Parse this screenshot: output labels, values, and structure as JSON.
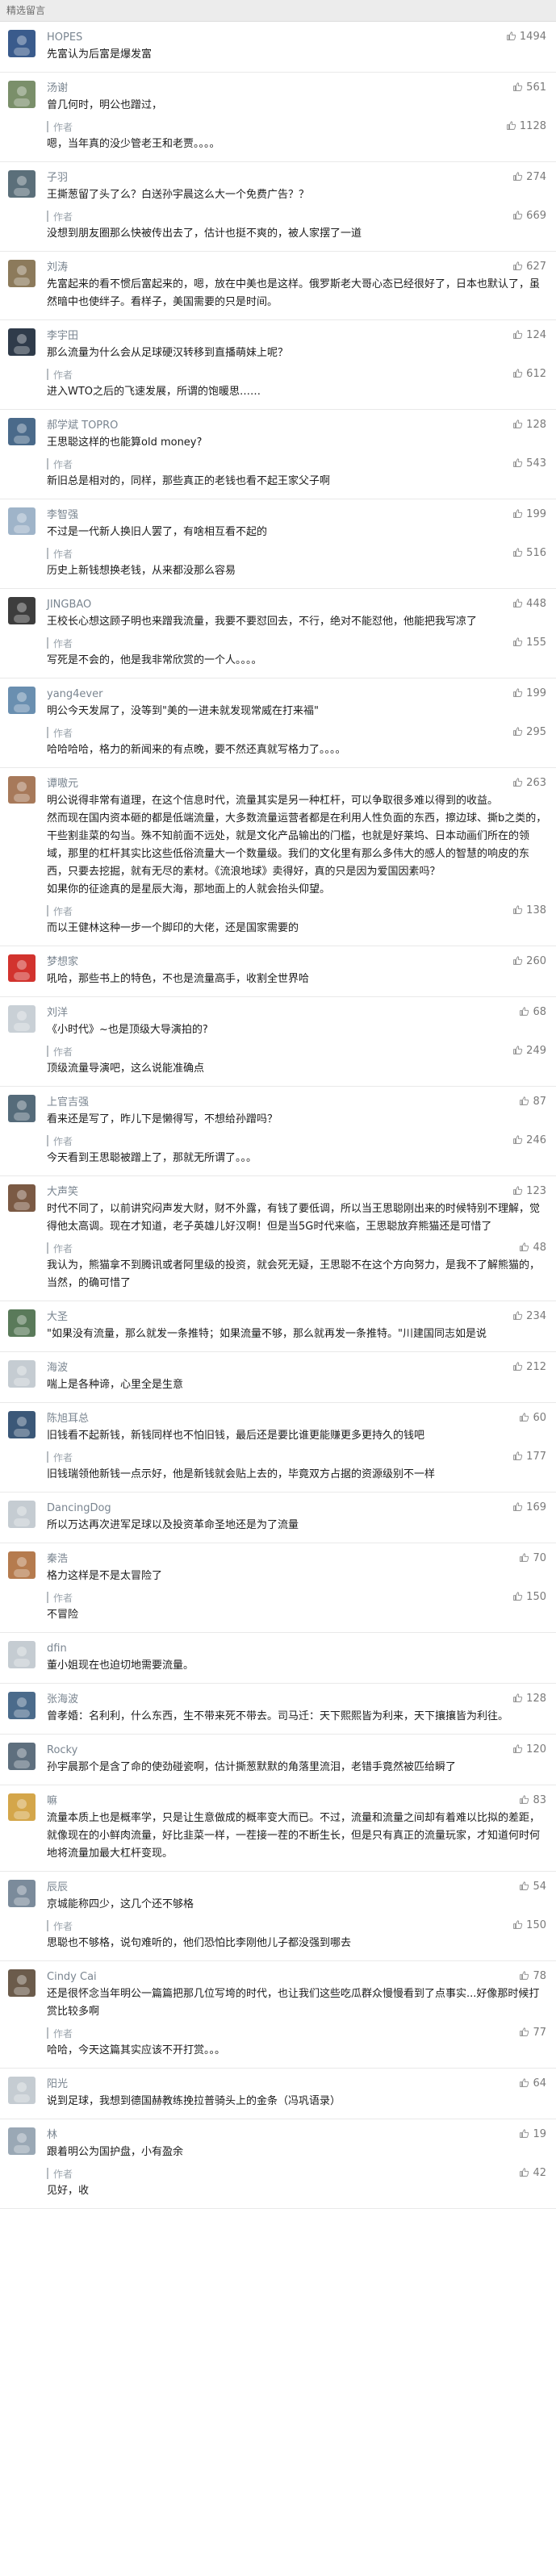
{
  "header": {
    "title": "精选留言"
  },
  "author_label": "作者",
  "comments": [
    {
      "name": "HOPES",
      "likes": "1494",
      "text": "先富认为后富是爆发富",
      "reply": null,
      "avatar_color": "#3a5b8c"
    },
    {
      "name": "汤谢",
      "likes": "561",
      "text": "曾几何时，明公也蹭过，",
      "reply": {
        "text": "嗯，当年真的没少管老王和老贾。。。。",
        "likes": "1128"
      },
      "avatar_color": "#7a8f6a"
    },
    {
      "name": "子羽",
      "likes": "274",
      "text": "王撕葱留了头了么？白送孙宇晨这么大一个免费广告？？",
      "reply": {
        "text": "没想到朋友圈那么快被传出去了，估计也挺不爽的，被人家摆了一道",
        "likes": "669"
      },
      "avatar_color": "#5b6f7a"
    },
    {
      "name": "刘涛",
      "likes": "627",
      "text": "先富起来的看不惯后富起来的，嗯，放在中美也是这样。俄罗斯老大哥心态已经很好了，日本也默认了，虽然暗中也使绊子。看样子，美国需要的只是时间。",
      "reply": null,
      "avatar_color": "#8c7a5b"
    },
    {
      "name": "李宇田",
      "likes": "124",
      "text": "那么流量为什么会从足球硬汉转移到直播萌妹上呢？",
      "reply": {
        "text": "进入WTO之后的飞速发展，所谓的饱暖思……",
        "likes": "612"
      },
      "avatar_color": "#2f3b4a"
    },
    {
      "name": "郝学斌 TOPRO",
      "likes": "128",
      "text": "王思聪这样的也能算old money?",
      "reply": {
        "text": "新旧总是相对的，同样，那些真正的老钱也看不起王家父子啊",
        "likes": "543"
      },
      "avatar_color": "#4a6a8a"
    },
    {
      "name": "李智强",
      "likes": "199",
      "text": "不过是一代新人换旧人罢了，有啥相互看不起的",
      "reply": {
        "text": "历史上新钱想换老钱，从来都没那么容易",
        "likes": "516"
      },
      "avatar_color": "#9fb4c9"
    },
    {
      "name": "JINGBAO",
      "likes": "448",
      "text": "王校长心想这顾子明也来蹭我流量，我要不要怼回去，不行，绝对不能怼他，他能把我写凉了",
      "reply": {
        "text": "写死是不会的，他是我非常欣赏的一个人。。。。",
        "likes": "155"
      },
      "avatar_color": "#3d3d3d"
    },
    {
      "name": "yang4ever",
      "likes": "199",
      "text": "明公今天发屌了，没等到\"美的一进未就发现常威在打来福\"",
      "reply": {
        "text": "哈哈哈哈，格力的新闻来的有点晚，要不然还真就写格力了。。。。",
        "likes": "295"
      },
      "avatar_color": "#6a8fb0"
    },
    {
      "name": "谭嗷元",
      "likes": "263",
      "text": "明公说得非常有道理，在这个信息时代，流量其实是另一种杠杆，可以争取很多难以得到的收益。\n然而现在国内资本砸的都是低端流量，大多数流量运营者都是在利用人性负面的东西，擦边球、撕b之类的，干些割韭菜的勾当。殊不知前面不远处，就是文化产品输出的门槛，也就是好莱坞、日本动画们所在的领域，那里的杠杆其实比这些低俗流量大一个数量级。我们的文化里有那么多伟大的感人的智慧的响皮的东西，只要去挖掘，就有无尽的素材。《流浪地球》卖得好，真的只是因为爱国因素吗？\n如果你的征途真的是星辰大海，那地面上的人就会抬头仰望。",
      "reply": {
        "text": "而以王健林这种一步一个脚印的大佬，还是国家需要的",
        "likes": "138"
      },
      "avatar_color": "#a7795a"
    },
    {
      "name": "梦想家",
      "likes": "260",
      "text": "吼哈，那些书上的特色，不也是流量高手，收割全世界哈",
      "reply": null,
      "avatar_color": "#d2332e"
    },
    {
      "name": "刘洋",
      "likes": "68",
      "text": "《小时代》~也是顶级大导演拍的?",
      "reply": {
        "text": "顶级流量导演吧，这么说能准确点",
        "likes": "249"
      },
      "avatar_color": "#c9d0d6"
    },
    {
      "name": "上官吉强",
      "likes": "87",
      "text": "看来还是写了，昨儿下是懒得写，不想给孙蹭吗？",
      "reply": {
        "text": "今天看到王思聪被蹭上了，那就无所谓了。。。",
        "likes": "246"
      },
      "avatar_color": "#556b7a"
    },
    {
      "name": "大声笑",
      "likes": "123",
      "text": "时代不同了，以前讲究闷声发大财，财不外露，有钱了要低调，所以当王思聪刚出来的时候特别不理解，觉得他太高调。现在才知道，老子英雄儿好汉啊！但是当5G时代来临，王思聪放弃熊猫还是可惜了",
      "reply": {
        "text": "我认为，熊猫拿不到腾讯或者阿里级的投资，就会死无疑，王思聪不在这个方向努力，是我不了解熊猫的，当然，的确可惜了",
        "likes": "48"
      },
      "avatar_color": "#7b5a44"
    },
    {
      "name": "大圣",
      "likes": "234",
      "text": "\"如果没有流量，那么就发一条推特；如果流量不够，那么就再发一条推特。\"川建国同志如是说",
      "reply": null,
      "avatar_color": "#5a7a5a"
    },
    {
      "name": "海波",
      "likes": "212",
      "text": "喘上是各种谛，心里全是生意",
      "reply": null,
      "avatar_color": "#c5ccd2"
    },
    {
      "name": "陈旭耳总",
      "likes": "60",
      "text": "旧钱看不起新钱，新钱同样也不怕旧钱，最后还是要比谁更能赚更多更持久的钱吧",
      "reply": {
        "text": "旧钱瑞领他新钱一点示好，他是新钱就会贴上去的，毕竟双方占据的资源级别不一样",
        "likes": "177"
      },
      "avatar_color": "#3b5878"
    },
    {
      "name": "DancingDog",
      "likes": "169",
      "text": "所以万达再次进军足球以及投资革命圣地还是为了流量",
      "reply": null,
      "avatar_color": "#c5ccd2"
    },
    {
      "name": "秦浩",
      "likes": "70",
      "text": "格力这样是不是太冒险了",
      "reply": {
        "text": "不冒险",
        "likes": "150"
      },
      "avatar_color": "#b57b4e"
    },
    {
      "name": "dfin",
      "likes": "",
      "text": "董小姐现在也迫切地需要流量。",
      "reply": null,
      "avatar_color": "#c5ccd2"
    },
    {
      "name": "张海波",
      "likes": "128",
      "text": "曾孝婚：名利利，什么东西，生不带来死不带去。司马迁：天下熙熙皆为利来，天下攘攘皆为利往。",
      "reply": null,
      "avatar_color": "#4b6b8b"
    },
    {
      "name": "Rocky",
      "likes": "120",
      "text": "孙宇晨那个是含了命的使劲碰瓷啊，估计撕葱默默的角落里流泪，老错手竟然被匹给瞬了",
      "reply": null,
      "avatar_color": "#5e6f7e"
    },
    {
      "name": "嘛",
      "likes": "83",
      "text": "流量本质上也是概率学，只是让生意做成的概率变大而已。不过，流量和流量之间却有着难以比拟的差距，就像现在的小鲜肉流量，好比韭菜一样，一茬接一茬的不断生长，但是只有真正的流量玩家，才知道何时何地将流量加最大杠杆变现。",
      "reply": null,
      "avatar_color": "#d4a64a"
    },
    {
      "name": "辰辰",
      "likes": "54",
      "text": "京城能称四少，这几个还不够格",
      "reply": {
        "text": "思聪也不够格，说句难听的，他们恐怕比李刚他儿子都没强到哪去",
        "likes": "150"
      },
      "avatar_color": "#7b8b9b"
    },
    {
      "name": "Cindy Cai",
      "likes": "78",
      "text": "还是很怀念当年明公一篇篇把那几位写垮的时代，也让我们这些吃瓜群众慢慢看到了点事实...好像那时候打赏比较多啊",
      "reply": {
        "text": "哈哈，今天这篇其实应该不开打赏。。。",
        "likes": "77"
      },
      "avatar_color": "#6b5b4b"
    },
    {
      "name": "阳光",
      "likes": "64",
      "text": "说到足球，我想到德国赫教练挽拉普骑头上的金条（冯巩语录）",
      "reply": null,
      "avatar_color": "#c5ccd2"
    },
    {
      "name": "林",
      "likes": "19",
      "text": "跟着明公为国护盘，小有盈余",
      "reply": {
        "text": "见好，收",
        "likes": "42"
      },
      "avatar_color": "#9aa8b5"
    }
  ]
}
